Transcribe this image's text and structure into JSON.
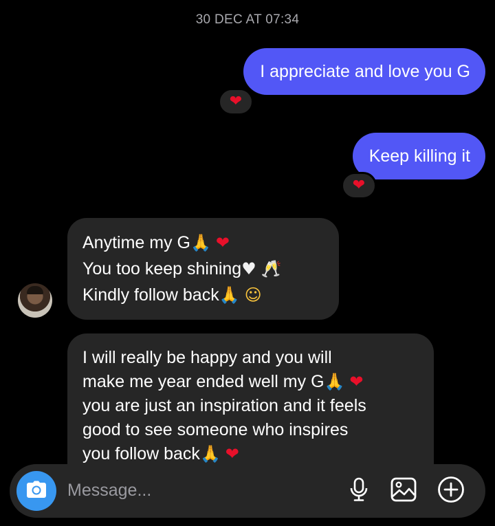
{
  "thread": {
    "timestamp": "30 DEC AT 07:34"
  },
  "messages": [
    {
      "direction": "outgoing",
      "text": "I appreciate and love you G",
      "reaction": "red-heart"
    },
    {
      "direction": "outgoing",
      "text": "Keep killing it",
      "reaction": "red-heart"
    },
    {
      "direction": "incoming",
      "lines": [
        {
          "text": "Anytime my G",
          "emojis": [
            "pray",
            "red-heart"
          ]
        },
        {
          "text": "You too keep shining",
          "emojis": [
            "white-heart",
            "champagne-glasses"
          ]
        },
        {
          "text": "Kindly follow back",
          "emojis": [
            "pray",
            "smile"
          ]
        }
      ]
    },
    {
      "direction": "incoming",
      "lines": [
        {
          "text": "I will really be happy and you will",
          "emojis": []
        },
        {
          "text": "make me year ended well my G",
          "emojis": [
            "pray",
            "red-heart"
          ]
        },
        {
          "text": "you are just an inspiration and it feels",
          "emojis": []
        },
        {
          "text": "good to see someone who inspires",
          "emojis": []
        },
        {
          "text": "you follow back",
          "emojis": [
            "pray",
            "red-heart"
          ]
        }
      ]
    }
  ],
  "composer": {
    "placeholder": "Message...",
    "icons": [
      "camera-icon",
      "microphone-icon",
      "gallery-icon",
      "plus-icon"
    ]
  },
  "colors": {
    "outgoing_bubble": "#5257f6",
    "incoming_bubble": "#262626",
    "background": "#000000",
    "camera_button": "#3897f0",
    "heart": "#e8102a"
  }
}
